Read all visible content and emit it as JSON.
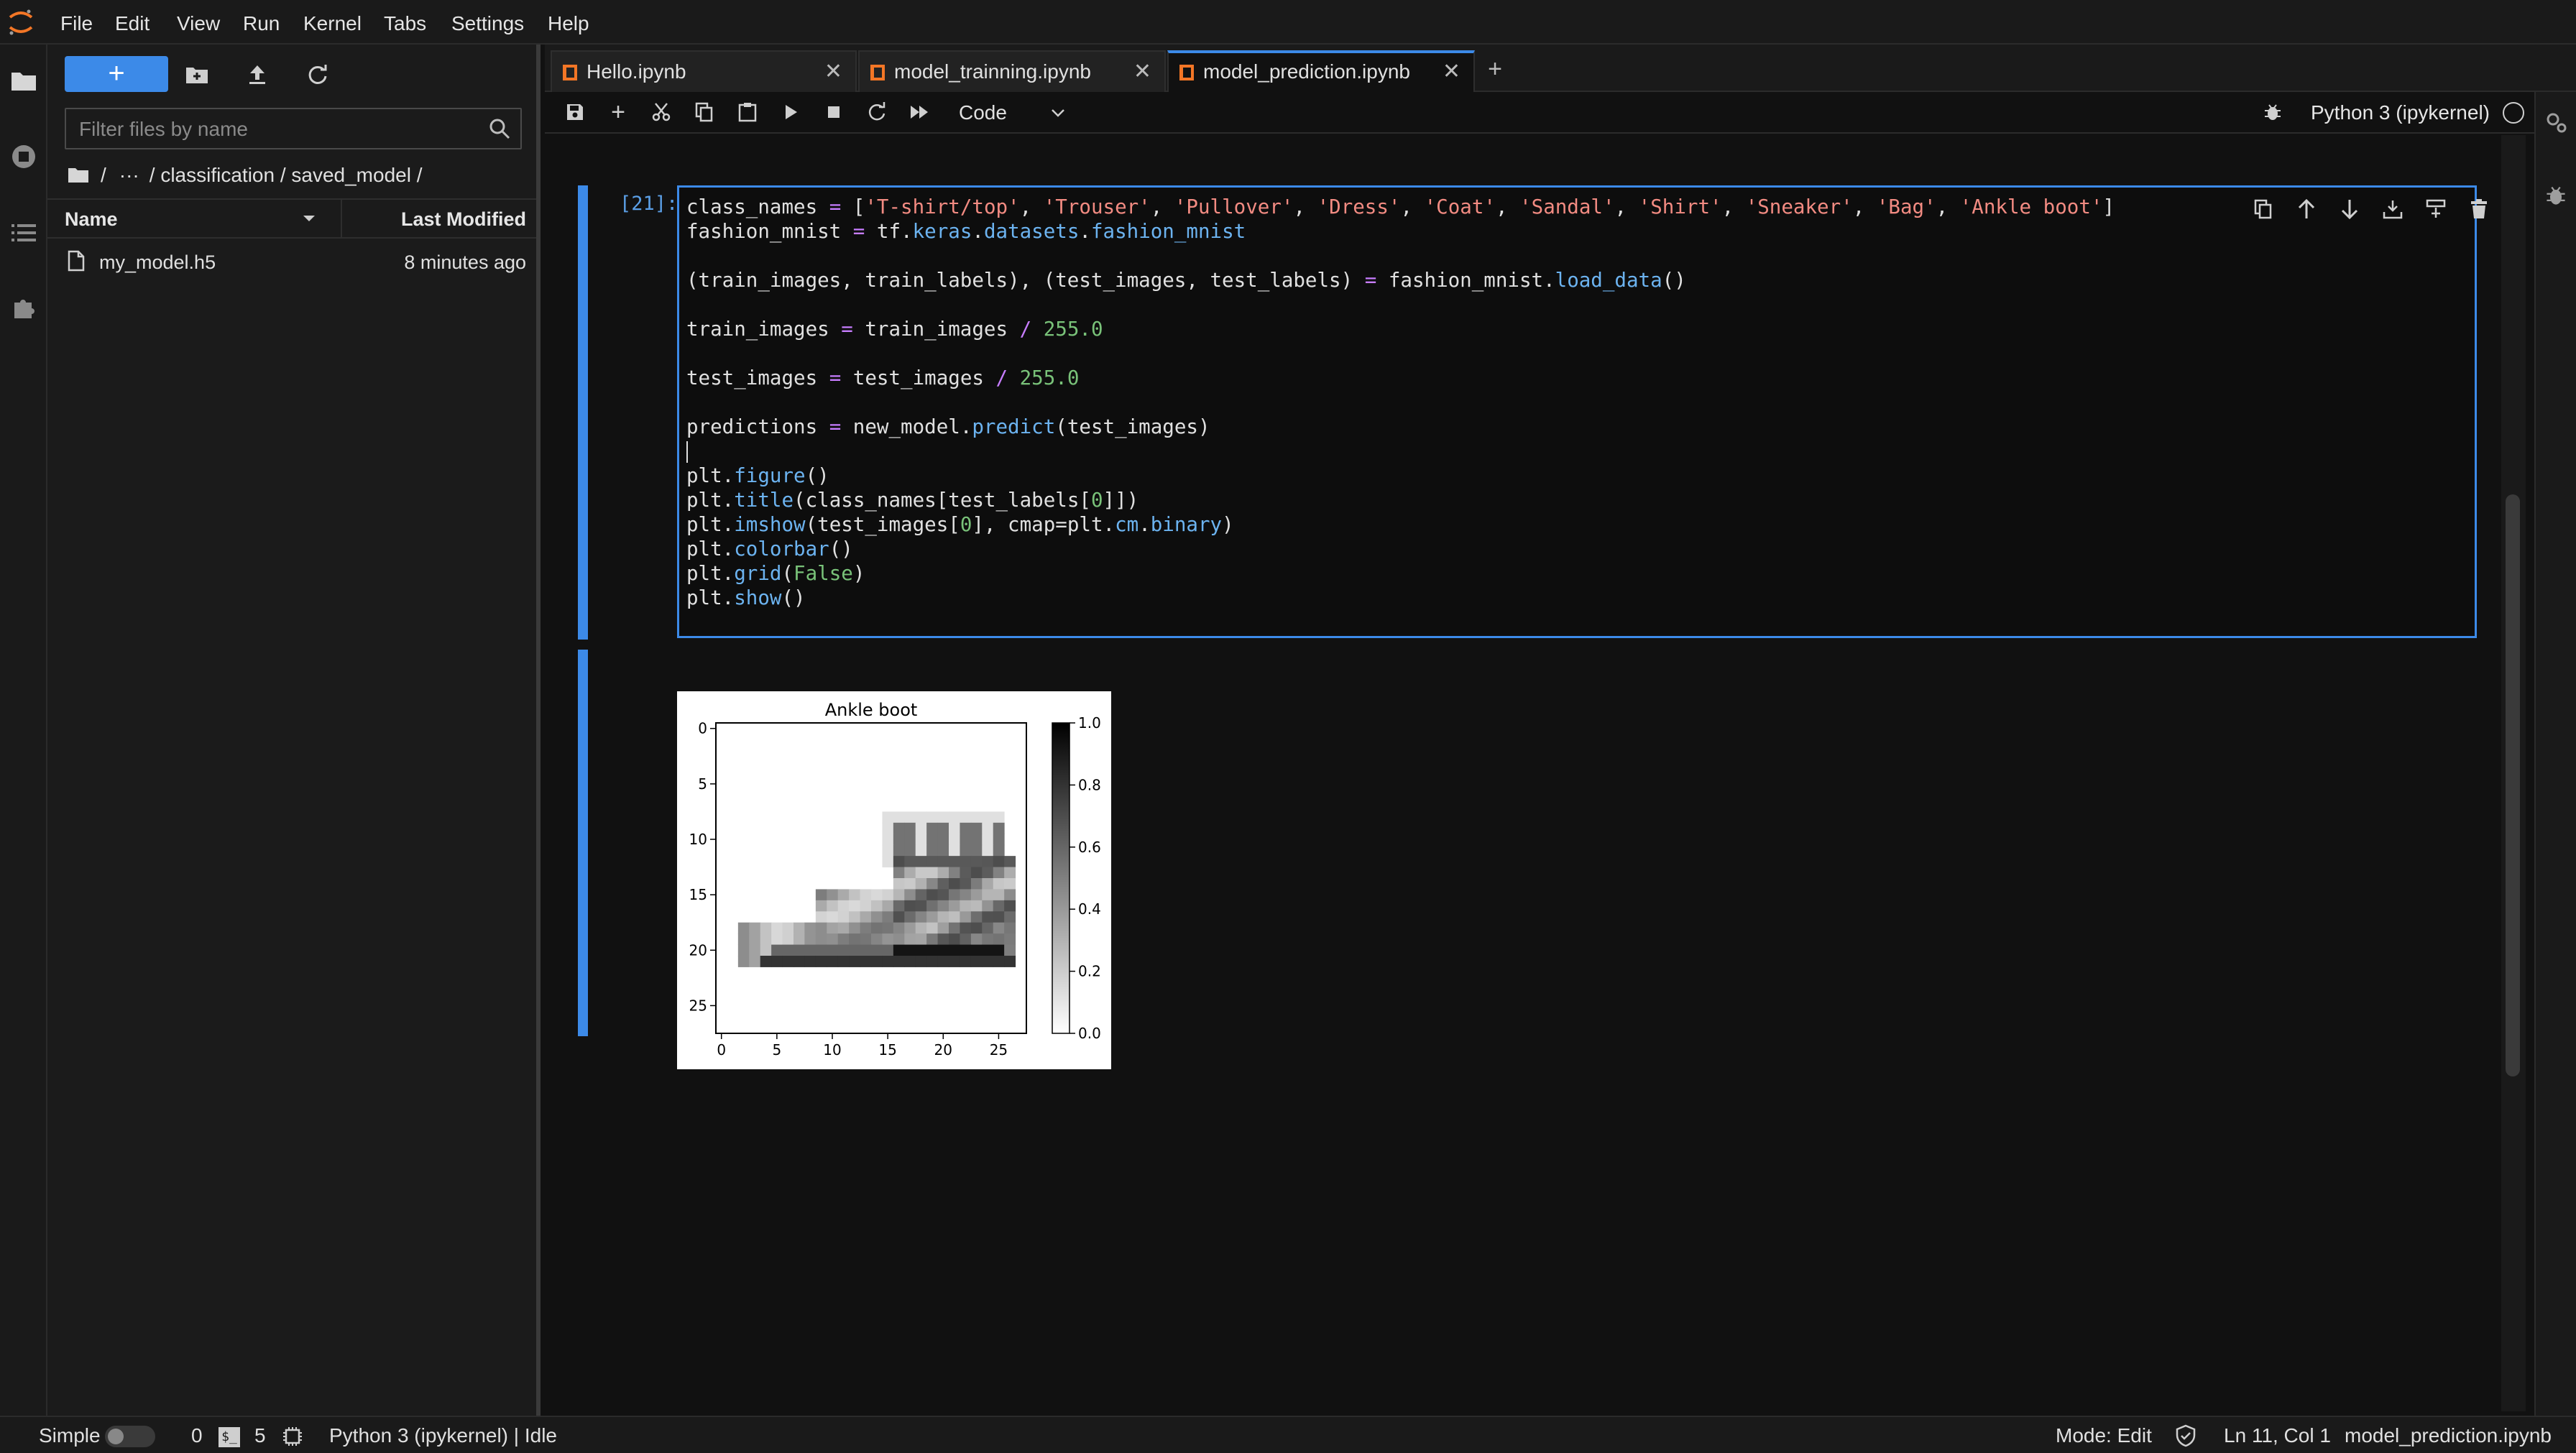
{
  "menubar": {
    "items": [
      "File",
      "Edit",
      "View",
      "Run",
      "Kernel",
      "Tabs",
      "Settings",
      "Help"
    ]
  },
  "activitybar": {
    "icons": [
      "folder-icon",
      "running-icon",
      "toc-icon",
      "extension-icon"
    ]
  },
  "filebrowser": {
    "new_label": "+",
    "filter_placeholder": "Filter files by name",
    "breadcrumb": {
      "ellipsis": "···",
      "path": "/ classification / saved_model /"
    },
    "columns": {
      "name": "Name",
      "modified": "Last Modified"
    },
    "files": [
      {
        "name": "my_model.h5",
        "modified": "8 minutes ago"
      }
    ]
  },
  "tabs": [
    {
      "label": "Hello.ipynb",
      "active": false
    },
    {
      "label": "model_trainning.ipynb",
      "active": false
    },
    {
      "label": "model_prediction.ipynb",
      "active": true
    }
  ],
  "toolbar": {
    "cell_type": "Code",
    "kernel": "Python 3 (ipykernel)"
  },
  "cell": {
    "prompt": "[21]:",
    "code_lines": [
      "class_names = ['T-shirt/top', 'Trouser', 'Pullover', 'Dress', 'Coat', 'Sandal', 'Shirt', 'Sneaker', 'Bag', 'Ankle boot']",
      "fashion_mnist = tf.keras.datasets.fashion_mnist",
      "",
      "(train_images, train_labels), (test_images, test_labels) = fashion_mnist.load_data()",
      "",
      "train_images = train_images / 255.0",
      "",
      "test_images = test_images / 255.0",
      "",
      "predictions = new_model.predict(test_images)",
      "",
      "plt.figure()",
      "plt.title(class_names[test_labels[0]])",
      "plt.imshow(test_images[0], cmap=plt.cm.binary)",
      "plt.colorbar()",
      "plt.grid(False)",
      "plt.show()"
    ]
  },
  "chart_data": {
    "type": "heatmap",
    "title": "Ankle boot",
    "xticks": [
      "0",
      "5",
      "10",
      "15",
      "20",
      "25"
    ],
    "yticks": [
      "0",
      "5",
      "10",
      "15",
      "20",
      "25"
    ],
    "xlim": [
      0,
      27
    ],
    "ylim": [
      27,
      0
    ],
    "colorbar": {
      "ticks": [
        "0.0",
        "0.2",
        "0.4",
        "0.6",
        "0.8",
        "1.0"
      ],
      "range": [
        0,
        1
      ],
      "cmap": "binary"
    },
    "grid": false
  },
  "statusbar": {
    "mode_label": "Simple",
    "terminals": "0",
    "kernels": "5",
    "kernel_status": "Python 3 (ipykernel) | Idle",
    "edit_mode": "Mode: Edit",
    "position": "Ln 11, Col 1",
    "filename": "model_prediction.ipynb"
  },
  "colors": {
    "accent": "#3c8ae8",
    "background": "#111111",
    "string": "#f28b82",
    "number": "#79c279"
  }
}
